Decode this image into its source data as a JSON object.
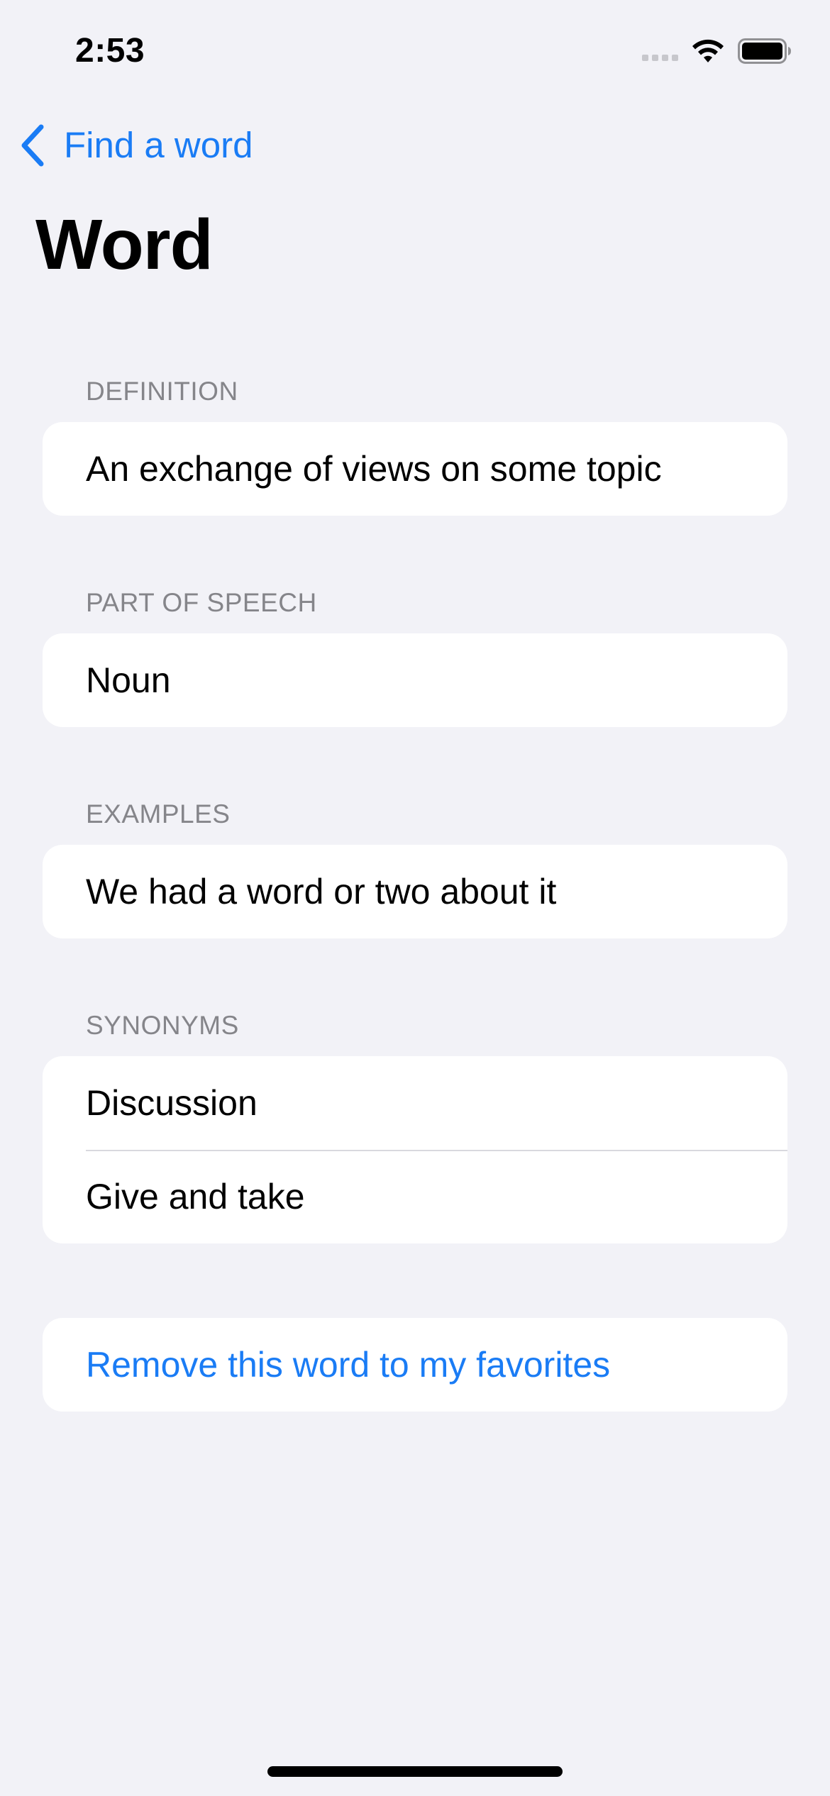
{
  "status_bar": {
    "time": "2:53",
    "icons": [
      "cellular-signal-icon",
      "wifi-icon",
      "battery-icon"
    ]
  },
  "nav": {
    "back_label": "Find a word",
    "title": "Word"
  },
  "sections": {
    "definition": {
      "header": "DEFINITION",
      "value": "An exchange of views on some topic"
    },
    "part_of_speech": {
      "header": "PART OF SPEECH",
      "value": "Noun"
    },
    "examples": {
      "header": "EXAMPLES",
      "value": "We had a word or two about it"
    },
    "synonyms": {
      "header": "SYNONYMS",
      "items": [
        "Discussion",
        "Give and take"
      ]
    }
  },
  "favorite_action": {
    "label": "Remove this word to my favorites"
  },
  "colors": {
    "accent": "#1a7cf5",
    "background": "#f2f2f7",
    "card": "#ffffff",
    "section_header": "#85858a"
  }
}
